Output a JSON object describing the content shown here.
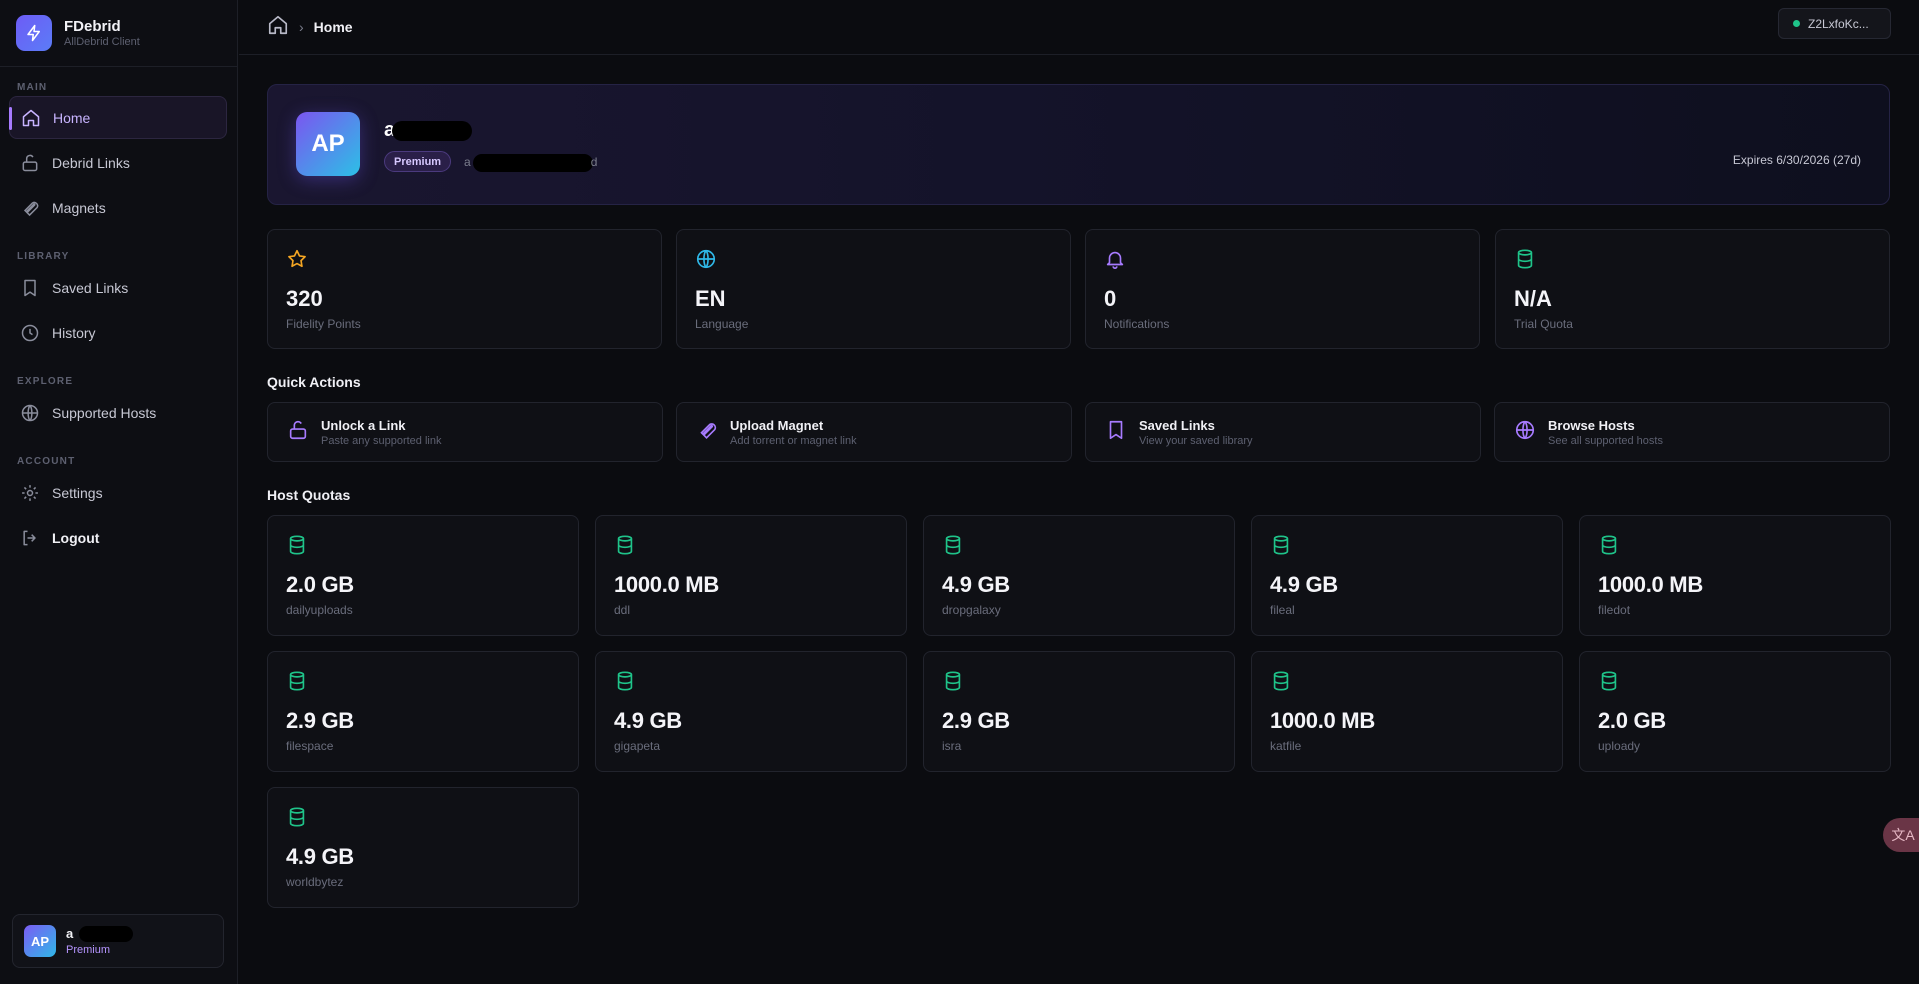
{
  "brand": {
    "title": "FDebrid",
    "subtitle": "AllDebrid Client"
  },
  "sidebar": {
    "sections": [
      {
        "label": "MAIN"
      },
      {
        "label": "LIBRARY"
      },
      {
        "label": "EXPLORE"
      },
      {
        "label": "ACCOUNT"
      }
    ],
    "items": [
      {
        "label": "Home",
        "icon": "home-icon"
      },
      {
        "label": "Debrid Links",
        "icon": "unlock-icon"
      },
      {
        "label": "Magnets",
        "icon": "magnet-icon"
      },
      {
        "label": "Saved Links",
        "icon": "bookmark-icon"
      },
      {
        "label": "History",
        "icon": "clock-icon"
      },
      {
        "label": "Supported Hosts",
        "icon": "globe-icon"
      },
      {
        "label": "Settings",
        "icon": "gear-icon"
      },
      {
        "label": "Logout",
        "icon": "logout-icon"
      }
    ],
    "user": {
      "initials": "AP",
      "name": "a",
      "plan": "Premium"
    }
  },
  "topbar": {
    "breadcrumb": {
      "separator": "›",
      "current": "Home"
    },
    "api_key": "Z2LxfoKc..."
  },
  "hero": {
    "initials": "AP",
    "name": "a",
    "badge": "Premium",
    "email_start": "a",
    "email_end": "d",
    "expires": "Expires 6/30/2026 (27d)"
  },
  "stats": [
    {
      "value": "320",
      "label": "Fidelity Points",
      "icon": "star-icon",
      "color": "#f5a623"
    },
    {
      "value": "EN",
      "label": "Language",
      "icon": "globe-icon",
      "color": "#2fb8e8"
    },
    {
      "value": "0",
      "label": "Notifications",
      "icon": "bell-icon",
      "color": "#a77bff"
    },
    {
      "value": "N/A",
      "label": "Trial Quota",
      "icon": "database-icon",
      "color": "#1fc48a"
    }
  ],
  "quick_actions": {
    "title": "Quick Actions",
    "items": [
      {
        "title": "Unlock a Link",
        "subtitle": "Paste any supported link",
        "icon": "unlock-icon"
      },
      {
        "title": "Upload Magnet",
        "subtitle": "Add torrent or magnet link",
        "icon": "magnet-icon"
      },
      {
        "title": "Saved Links",
        "subtitle": "View your saved library",
        "icon": "bookmark-icon"
      },
      {
        "title": "Browse Hosts",
        "subtitle": "See all supported hosts",
        "icon": "globe-icon"
      }
    ]
  },
  "host_quotas": {
    "title": "Host Quotas",
    "items": [
      {
        "value": "2.0 GB",
        "host": "dailyuploads"
      },
      {
        "value": "1000.0 MB",
        "host": "ddl"
      },
      {
        "value": "4.9 GB",
        "host": "dropgalaxy"
      },
      {
        "value": "4.9 GB",
        "host": "fileal"
      },
      {
        "value": "1000.0 MB",
        "host": "filedot"
      },
      {
        "value": "2.9 GB",
        "host": "filespace"
      },
      {
        "value": "4.9 GB",
        "host": "gigapeta"
      },
      {
        "value": "2.9 GB",
        "host": "isra"
      },
      {
        "value": "1000.0 MB",
        "host": "katfile"
      },
      {
        "value": "2.0 GB",
        "host": "uploady"
      },
      {
        "value": "4.9 GB",
        "host": "worldbytez"
      }
    ]
  },
  "colors": {
    "accent": "#a77bff",
    "quota_icon": "#1fc48a",
    "status": "#1fc48a"
  }
}
